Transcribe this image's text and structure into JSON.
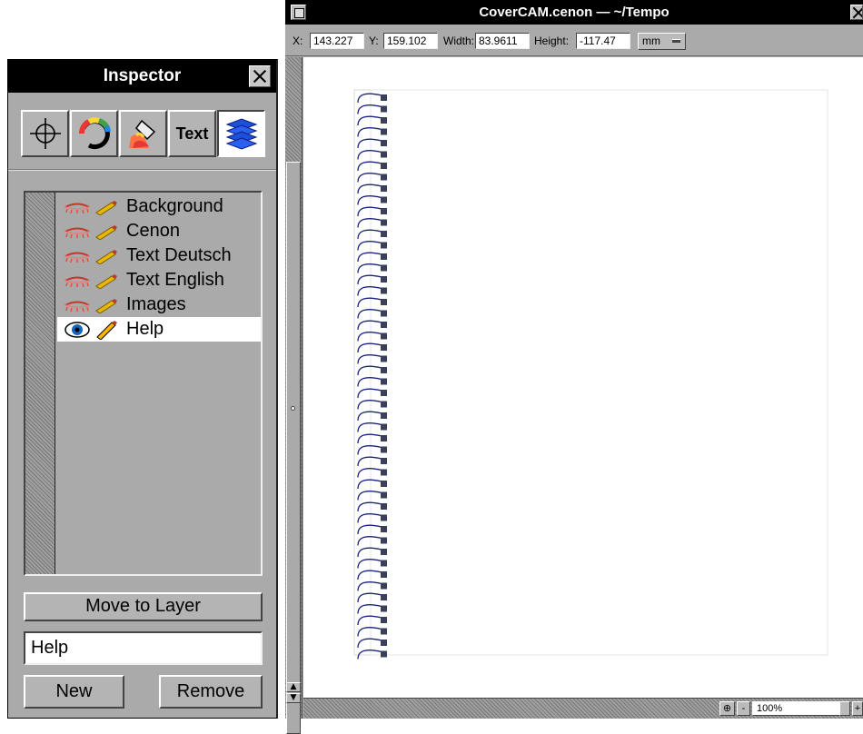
{
  "inspector": {
    "title": "Inspector",
    "tools": [
      {
        "name": "crosshair-icon"
      },
      {
        "name": "color-wheel-icon"
      },
      {
        "name": "paint-bucket-icon"
      },
      {
        "name": "text-tool",
        "label": "Text"
      },
      {
        "name": "layers-icon"
      }
    ],
    "layers": [
      {
        "label": "Background",
        "visible_icon": "eye-closed-icon",
        "edit_icon": "pencil-icon"
      },
      {
        "label": "Cenon",
        "visible_icon": "eye-closed-icon",
        "edit_icon": "pencil-icon"
      },
      {
        "label": "Text Deutsch",
        "visible_icon": "eye-closed-icon",
        "edit_icon": "pencil-icon"
      },
      {
        "label": "Text English",
        "visible_icon": "eye-closed-icon",
        "edit_icon": "pencil-icon"
      },
      {
        "label": "Images",
        "visible_icon": "eye-closed-icon",
        "edit_icon": "pencil-icon"
      },
      {
        "label": "Help",
        "visible_icon": "eye-open-icon",
        "edit_icon": "pencil-icon",
        "selected": true
      }
    ],
    "move_to_layer_label": "Move to Layer",
    "layer_name_value": "Help",
    "new_label": "New",
    "remove_label": "Remove"
  },
  "document": {
    "title": "CoverCAM.cenon  —  ~/Tempo",
    "coords": {
      "x_label": "X:",
      "x_value": "143.227",
      "y_label": "Y:",
      "y_value": "159.102",
      "width_label": "Width:",
      "width_value": "83.9611",
      "height_label": "Height:",
      "height_value": "-117.47",
      "unit": "mm"
    },
    "zoom_value": "100%",
    "zoom_minus": "-",
    "zoom_plus": "+"
  },
  "colors": {
    "selection": "#ffffff",
    "spiral": "#1a237e",
    "panel": "#aaaaaa"
  }
}
